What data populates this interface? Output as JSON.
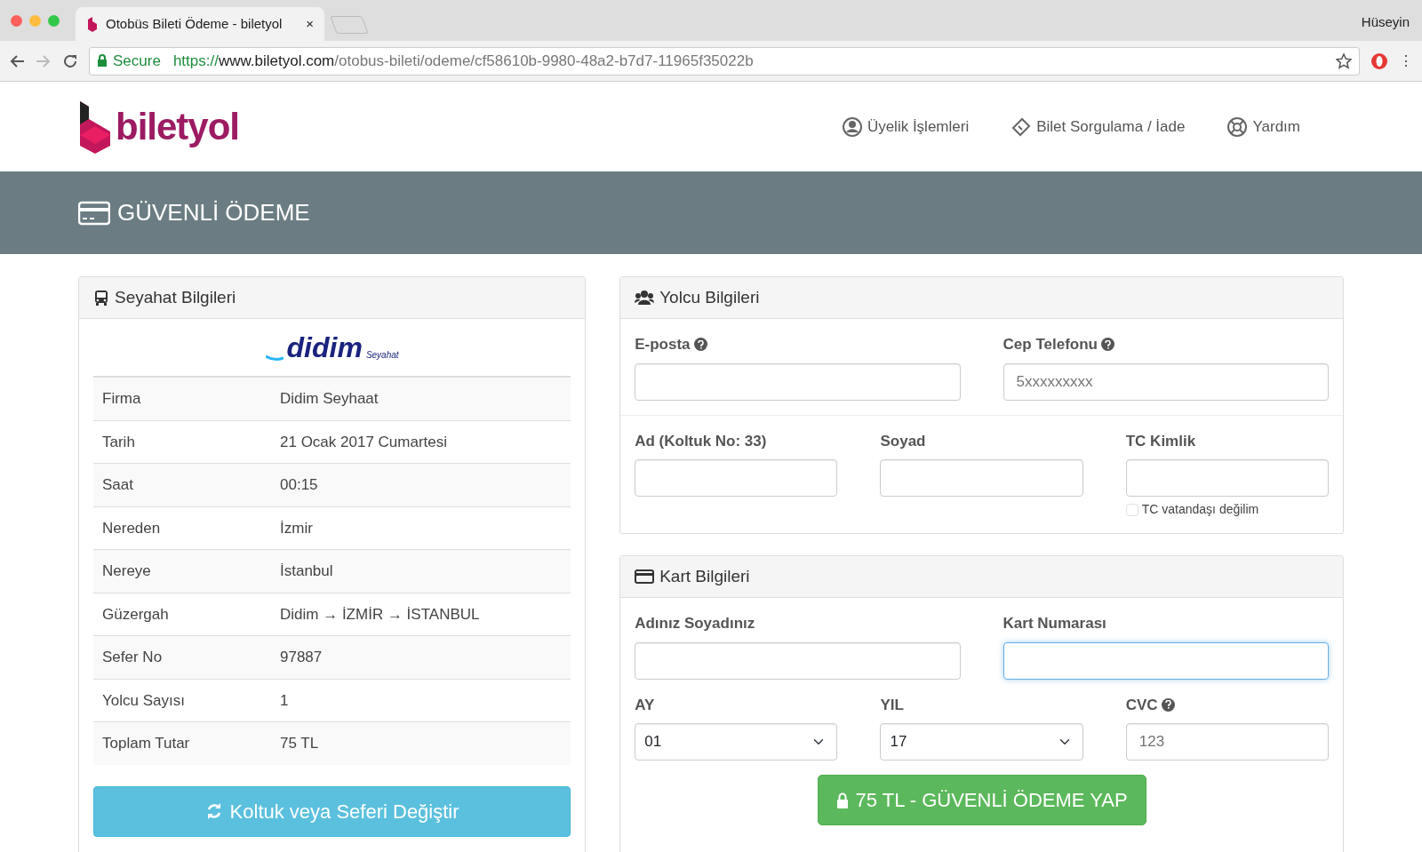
{
  "browser": {
    "tab_title": "Otobüs Bileti Ödeme - biletyol",
    "tab_close": "×",
    "profile": "Hüseyin",
    "secure_label": "Secure",
    "url_scheme": "https://",
    "url_host": "www.biletyol.com",
    "url_path": "/otobus-bileti/odeme/cf58610b-9980-48a2-b7d7-11965f35022b",
    "menu": "⋮"
  },
  "header": {
    "logo_text": "biletyol",
    "nav": [
      {
        "label": "Üyelik İşlemleri",
        "kind": "user"
      },
      {
        "label": "Bilet Sorgulama / İade",
        "kind": "ticket"
      },
      {
        "label": "Yardım",
        "kind": "lifebuoy"
      }
    ]
  },
  "banner": {
    "title": "GÜVENLİ ÖDEME"
  },
  "trip": {
    "title": "Seyahat Bilgileri",
    "company_logo": {
      "name": "didim",
      "sub": "Seyahat"
    },
    "rows": [
      {
        "label": "Firma",
        "value": "Didim Seyhaat"
      },
      {
        "label": "Tarih",
        "value": "21 Ocak 2017 Cumartesi"
      },
      {
        "label": "Saat",
        "value": "00:15"
      },
      {
        "label": "Nereden",
        "value": "İzmir"
      },
      {
        "label": "Nereye",
        "value": "İstanbul"
      },
      {
        "label": "Güzergah",
        "value": "Didim → İZMİR → İSTANBUL"
      },
      {
        "label": "Sefer No",
        "value": "97887"
      },
      {
        "label": "Yolcu Sayısı",
        "value": "1"
      },
      {
        "label": "Toplam Tutar",
        "value": "75 TL"
      }
    ],
    "change_button": "Koltuk veya Seferi Değiştir"
  },
  "passenger": {
    "title": "Yolcu Bilgileri",
    "row1": [
      {
        "label": "E-posta",
        "help": true
      },
      {
        "label": "Cep Telefonu",
        "help": true,
        "placeholder": "5xxxxxxxxx"
      }
    ],
    "row2": [
      {
        "label": "Ad (Koltuk No: 33)"
      },
      {
        "label": "Soyad"
      },
      {
        "label": "TC Kimlik"
      }
    ],
    "not_citizen": {
      "label": "TC vatandaşı değilim",
      "checked": false
    }
  },
  "card": {
    "title": "Kart Bilgileri",
    "row1": [
      {
        "label": "Adınız Soyadınız",
        "focused": false
      },
      {
        "label": "Kart Numarası",
        "focused": true
      }
    ],
    "month": {
      "label": "AY",
      "value": "01"
    },
    "year": {
      "label": "YIL",
      "value": "17"
    },
    "cvc": {
      "label": "CVC",
      "help": true,
      "placeholder": "123"
    },
    "pay_button": "75 TL - GÜVENLİ ÖDEME YAP"
  }
}
